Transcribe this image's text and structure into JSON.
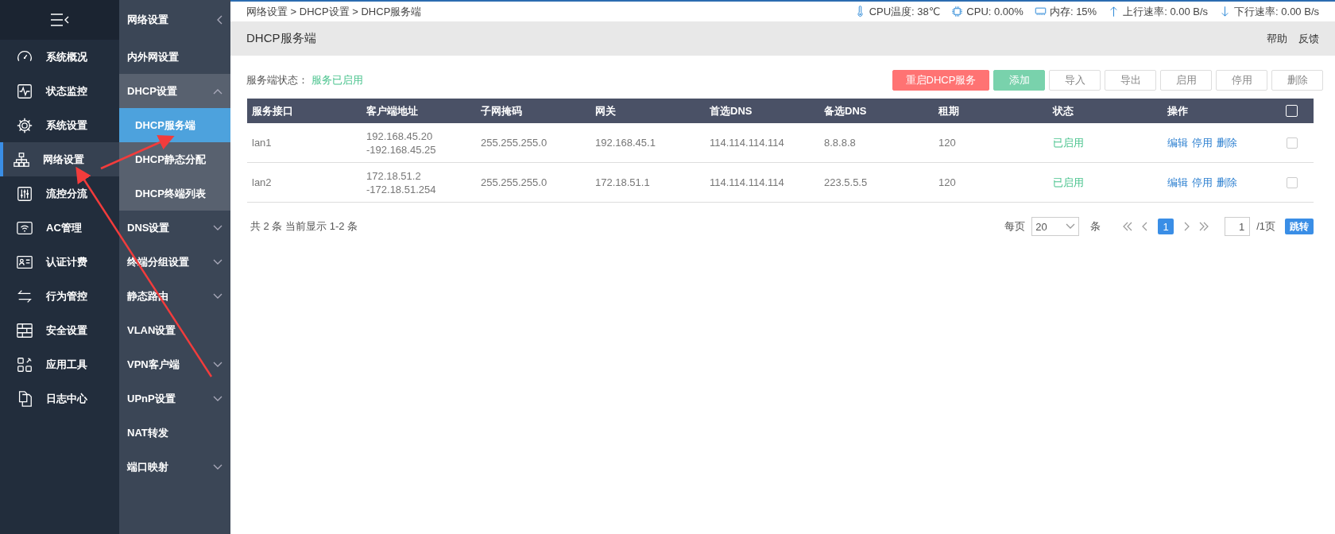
{
  "sidebar": {
    "menu": [
      {
        "label": "系统概况",
        "kind": "gauge",
        "selected": false
      },
      {
        "label": "状态监控",
        "kind": "pulse",
        "selected": false
      },
      {
        "label": "系统设置",
        "kind": "gear",
        "selected": false
      },
      {
        "label": "网络设置",
        "kind": "network",
        "selected": true
      },
      {
        "label": "流控分流",
        "kind": "sliders",
        "selected": false
      },
      {
        "label": "AC管理",
        "kind": "wifi",
        "selected": false
      },
      {
        "label": "认证计费",
        "kind": "card",
        "selected": false
      },
      {
        "label": "行为管控",
        "kind": "arrows",
        "selected": false
      },
      {
        "label": "安全设置",
        "kind": "wall",
        "selected": false
      },
      {
        "label": "应用工具",
        "kind": "apps",
        "selected": false
      },
      {
        "label": "日志中心",
        "kind": "docs",
        "selected": false
      }
    ]
  },
  "submenu": {
    "title": "网络设置",
    "items": [
      {
        "label": "内外网设置",
        "expanded": false,
        "has_children": false
      },
      {
        "label": "DHCP设置",
        "expanded": true,
        "has_children": true,
        "children": [
          {
            "label": "DHCP服务端",
            "selected": true
          },
          {
            "label": "DHCP静态分配",
            "selected": false
          },
          {
            "label": "DHCP终端列表",
            "selected": false
          }
        ]
      },
      {
        "label": "DNS设置",
        "expanded": false,
        "has_children": true
      },
      {
        "label": "终端分组设置",
        "expanded": false,
        "has_children": true
      },
      {
        "label": "静态路由",
        "expanded": false,
        "has_children": true
      },
      {
        "label": "VLAN设置",
        "expanded": false,
        "has_children": false
      },
      {
        "label": "VPN客户端",
        "expanded": false,
        "has_children": true
      },
      {
        "label": "UPnP设置",
        "expanded": false,
        "has_children": true
      },
      {
        "label": "NAT转发",
        "expanded": false,
        "has_children": false
      },
      {
        "label": "端口映射",
        "expanded": false,
        "has_children": true
      }
    ]
  },
  "breadcrumb": "网络设置 > DHCP设置 > DHCP服务端",
  "stats": [
    {
      "kind": "thermometer",
      "text": "CPU温度: 38℃"
    },
    {
      "kind": "chip",
      "text": "CPU: 0.00%"
    },
    {
      "kind": "memory",
      "text": "内存: 15%"
    },
    {
      "kind": "up",
      "text": "上行速率: 0.00 B/s"
    },
    {
      "kind": "down",
      "text": "下行速率: 0.00 B/s"
    }
  ],
  "page_title": "DHCP服务端",
  "header_links": [
    "帮助",
    "反馈"
  ],
  "server_status": {
    "label": "服务端状态：",
    "value": "服务已启用"
  },
  "buttons": [
    {
      "label": "重启DHCP服务",
      "kind": "danger"
    },
    {
      "label": "添加",
      "kind": "success"
    },
    {
      "label": "导入",
      "kind": "default"
    },
    {
      "label": "导出",
      "kind": "default"
    },
    {
      "label": "启用",
      "kind": "default"
    },
    {
      "label": "停用",
      "kind": "default"
    },
    {
      "label": "删除",
      "kind": "default"
    }
  ],
  "table": {
    "columns": [
      "服务接口",
      "客户端地址",
      "子网掩码",
      "网关",
      "首选DNS",
      "备选DNS",
      "租期",
      "状态",
      "操作"
    ],
    "header_checked": false,
    "rows": [
      {
        "cells": [
          "lan1",
          "192.168.45.20\n-192.168.45.25",
          "255.255.255.0",
          "192.168.45.1",
          "114.114.114.114",
          "8.8.8.8",
          "120"
        ],
        "status": "已启用",
        "actions": [
          "编辑",
          "停用",
          "删除"
        ],
        "checked": false
      },
      {
        "cells": [
          "lan2",
          "172.18.51.2\n-172.18.51.254",
          "255.255.255.0",
          "172.18.51.1",
          "114.114.114.114",
          "223.5.5.5",
          "120"
        ],
        "status": "已启用",
        "actions": [
          "编辑",
          "停用",
          "删除"
        ],
        "checked": false
      }
    ]
  },
  "pagination": {
    "summary": "共 2 条 当前显示 1-2 条",
    "per_page_label": "每页",
    "per_page": "20",
    "unit": "条",
    "pages": [
      {
        "label": "1",
        "selected": true
      }
    ],
    "jump_value": "1",
    "total_pages": "/1页",
    "jump_button": "跳转"
  }
}
